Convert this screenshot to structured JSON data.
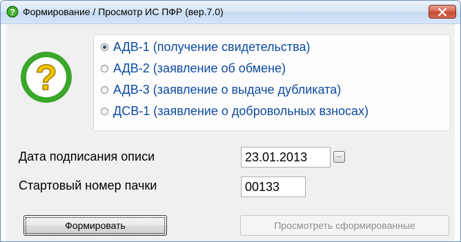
{
  "window": {
    "title": "Формирование / Просмотр ИС ПФР (вер.7.0)",
    "icon": "question-circle-icon",
    "close_icon": "close-x-icon"
  },
  "options": {
    "selected_index": 0,
    "items": [
      {
        "label": "АДВ-1 (получение свидетельства)",
        "checked": true
      },
      {
        "label": "АДВ-2 (заявление об обмене)",
        "checked": false
      },
      {
        "label": "АДВ-3 (заявление о выдаче дубликата)",
        "checked": false
      },
      {
        "label": "ДСВ-1 (заявление о добровольных взносах)",
        "checked": false
      }
    ]
  },
  "form": {
    "date_label": "Дата подписания описи",
    "date_value": "23.01.2013",
    "date_picker_label": "...",
    "start_label": "Стартовый номер пачки",
    "start_value": "00133"
  },
  "buttons": {
    "generate": "Формировать",
    "view": "Просмотреть сформированные"
  },
  "colors": {
    "icon_green": "#3aa72a",
    "option_text": "#0d4aa0",
    "close_button": "#c9503a"
  }
}
